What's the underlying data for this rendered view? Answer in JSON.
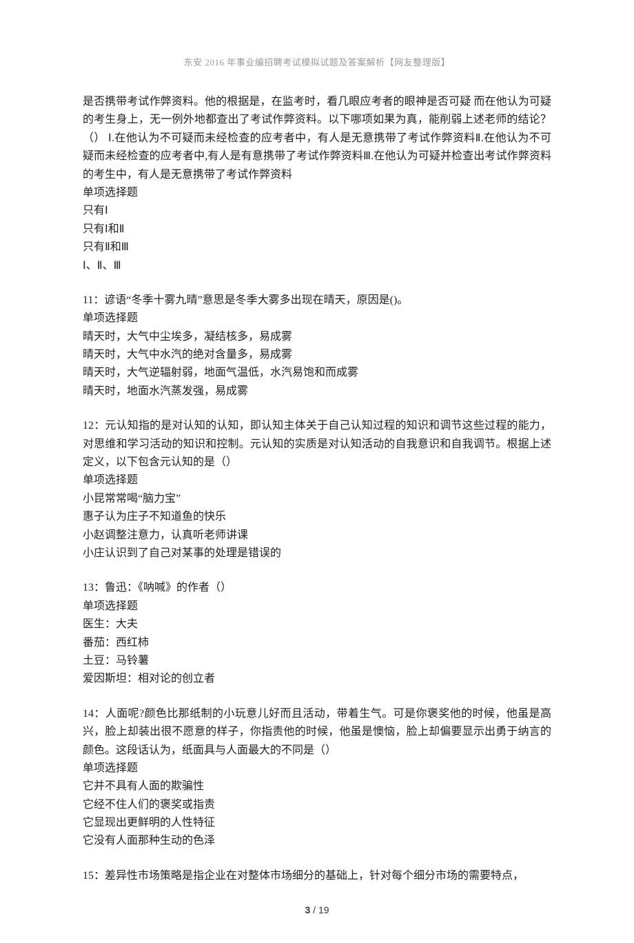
{
  "header": "东安 2016 年事业编招聘考试模拟试题及答案解析【网友整理版】",
  "footer": {
    "current": "3",
    "sep": " / ",
    "total": "19"
  },
  "blocks": [
    {
      "lines": [
        "是否携带考试作弊资料。他的根据是，在监考时，看几眼应考者的眼神是否可疑 而在他认为可疑的考生身上，无一例外地都查出了考试作弊资料。以下哪项如果为真，能削弱上述老师的结论？（） Ⅰ.在他认为不可疑而未经检查的应考者中，有人是无意携带了考试作弊资料Ⅱ.在他认为不可疑而未经检查的应考者中,有人是有意携带了考试作弊资料Ⅲ.在他认为可疑并检查出考试作弊资料的考生中，有人是无意携带了考试作弊资料",
        "单项选择题",
        "只有Ⅰ",
        "只有Ⅰ和Ⅱ",
        "只有Ⅱ和Ⅲ",
        "Ⅰ、Ⅱ、Ⅲ"
      ]
    },
    {
      "lines": [
        "11：谚语“冬季十雾九晴”意思是冬季大雾多出现在晴天，原因是()。",
        "单项选择题",
        "晴天时，大气中尘埃多，凝结核多，易成雾",
        "晴天时，大气中水汽的绝对含量多，易成雾",
        "晴天时，大气逆辐射弱，地面气温低，水汽易饱和而成雾",
        "晴天时，地面水汽蒸发强，易成雾"
      ]
    },
    {
      "lines": [
        "12：元认知指的是对认知的认知，即认知主体关于自己认知过程的知识和调节这些过程的能力，对思维和学习活动的知识和控制。元认知的实质是对认知活动的自我意识和自我调节。根据上述定义，以下包含元认知的是（）",
        "单项选择题",
        "小昆常常喝“脑力宝”",
        "惠子认为庄子不知道鱼的快乐",
        "小赵调整注意力，认真听老师讲课",
        "小庄认识到了自己对某事的处理是错误的"
      ]
    },
    {
      "lines": [
        "13：鲁迅：《呐喊》的作者（）",
        "单项选择题",
        "医生：大夫",
        "番茄：西红柿",
        "土豆：马铃薯",
        "爱因斯坦：相对论的创立者"
      ]
    },
    {
      "lines": [
        "14：人面呢?颜色比那纸制的小玩意儿好而且活动，带着生气。可是你褒奖他的时候，他虽是高兴，脸上却装出很不愿意的样子，你指责他的时候，他虽是懊恼，脸上却偏要显示出勇于纳言的颜色。这段话认为，纸面具与人面最大的不同是（）",
        "单项选择题",
        "它并不具有人面的欺骗性",
        "它经不住人们的褒奖或指责",
        "它显现出更鲜明的人性特征",
        "它没有人面那种生动的色泽"
      ]
    },
    {
      "lines": [
        "15：差异性市场策略是指企业在对整体市场细分的基础上，针对每个细分市场的需要特点，"
      ]
    }
  ]
}
